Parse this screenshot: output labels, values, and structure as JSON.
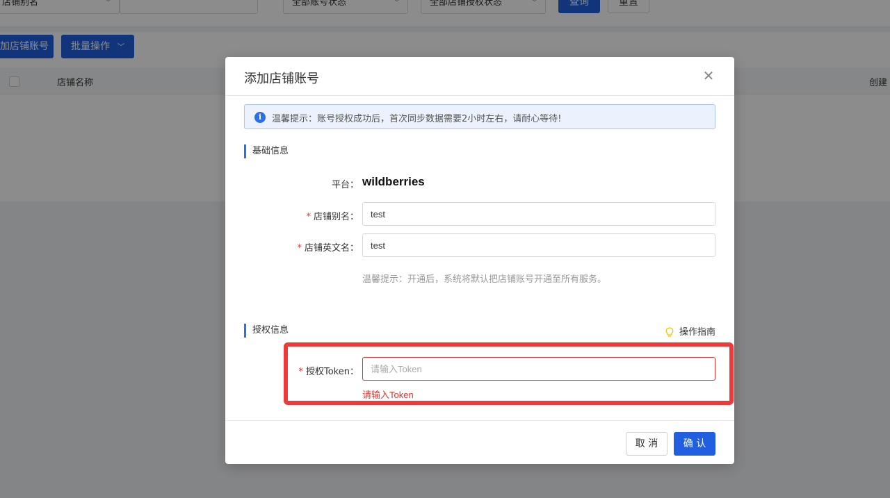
{
  "background": {
    "filters": {
      "alias_select": "店铺别名",
      "account_status_select": "全部账号状态",
      "auth_status_select": "全部店铺授权状态",
      "query_button": "查询",
      "reset_button": "重置"
    },
    "actions": {
      "add_shop_button": "加店铺账号",
      "batch_button": "批量操作"
    },
    "table": {
      "columns": [
        "店铺名称",
        "创建"
      ]
    }
  },
  "modal": {
    "title": "添加店铺账号",
    "alert_text": "温馨提示：账号授权成功后，首次同步数据需要2小时左右，请耐心等待!",
    "basic_section": "基础信息",
    "platform_label": "平台：",
    "platform_value": "wildberries",
    "alias_label": "店铺别名：",
    "alias_value": "test",
    "en_name_label": "店铺英文名：",
    "en_name_value": "test",
    "hint": "温馨提示：开通后，系统将默认把店铺账号开通至所有服务。",
    "auth_section": "授权信息",
    "guide_link": "操作指南",
    "token_label": "授权Token：",
    "token_placeholder": "请输入Token",
    "token_error": "请输入Token",
    "cancel_button": "取 消",
    "confirm_button": "确 认"
  },
  "colors": {
    "primary": "#1f5fe0",
    "error": "#e0302c",
    "highlight": "#f03a3a"
  }
}
